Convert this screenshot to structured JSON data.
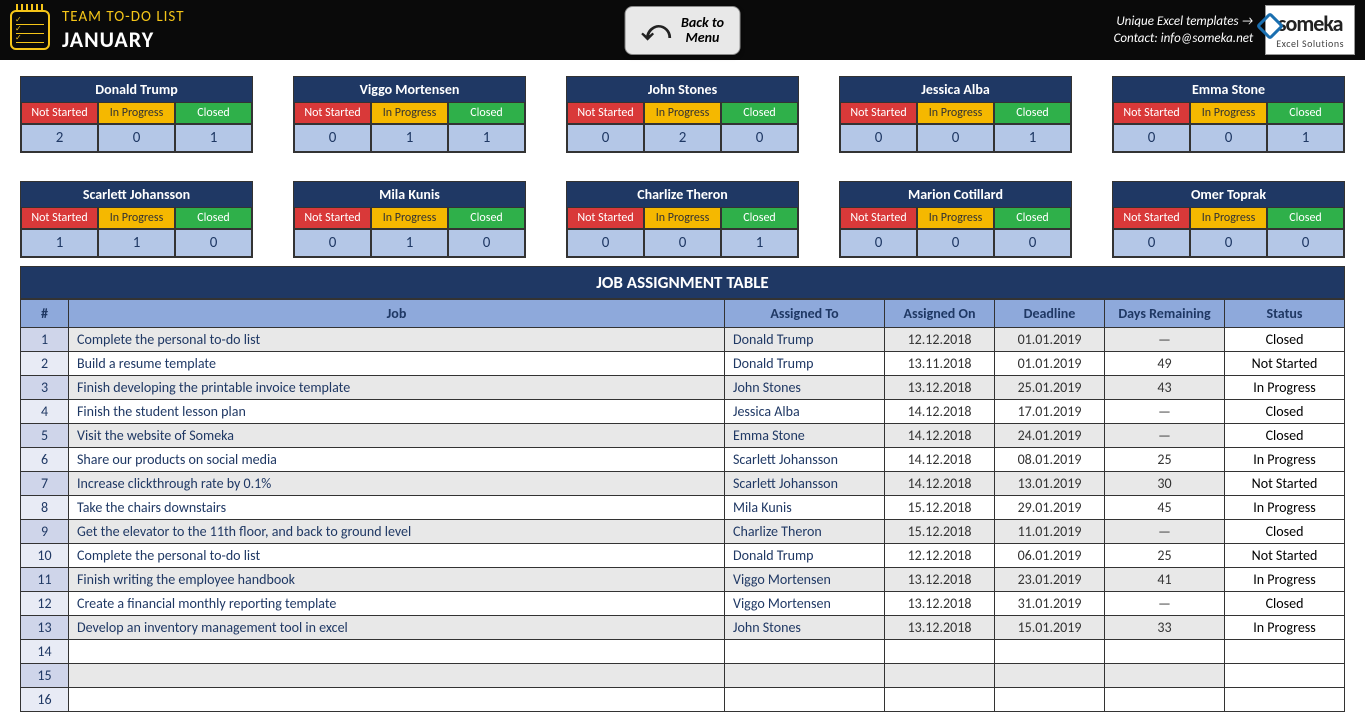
{
  "header": {
    "title_top": "TEAM TO-DO LIST",
    "title_bottom": "JANUARY",
    "back_arrow": "⤺",
    "back_line1": "Back to",
    "back_line2": "Menu",
    "templates_link": "Unique Excel templates →",
    "contact": "Contact: info@someka.net",
    "brand": "someka",
    "brand_sub": "Excel Solutions"
  },
  "status_labels": {
    "ns": "Not Started",
    "ip": "In Progress",
    "cl": "Closed"
  },
  "people": [
    {
      "name": "Donald Trump",
      "ns": 2,
      "ip": 0,
      "cl": 1
    },
    {
      "name": "Viggo Mortensen",
      "ns": 0,
      "ip": 1,
      "cl": 1
    },
    {
      "name": "John Stones",
      "ns": 0,
      "ip": 2,
      "cl": 0
    },
    {
      "name": "Jessica Alba",
      "ns": 0,
      "ip": 0,
      "cl": 1
    },
    {
      "name": "Emma Stone",
      "ns": 0,
      "ip": 0,
      "cl": 1
    },
    {
      "name": "Scarlett Johansson",
      "ns": 1,
      "ip": 1,
      "cl": 0
    },
    {
      "name": "Mila Kunis",
      "ns": 0,
      "ip": 1,
      "cl": 0
    },
    {
      "name": "Charlize Theron",
      "ns": 0,
      "ip": 0,
      "cl": 1
    },
    {
      "name": "Marion Cotillard",
      "ns": 0,
      "ip": 0,
      "cl": 0
    },
    {
      "name": "Omer Toprak",
      "ns": 0,
      "ip": 0,
      "cl": 0
    }
  ],
  "table": {
    "title": "JOB ASSIGNMENT TABLE",
    "headers": {
      "num": "#",
      "job": "Job",
      "assigned_to": "Assigned To",
      "assigned_on": "Assigned On",
      "deadline": "Deadline",
      "days": "Days Remaining",
      "status": "Status"
    },
    "rows": [
      {
        "num": 1,
        "job": "Complete the personal to-do list",
        "assigned_to": "Donald Trump",
        "assigned_on": "12.12.2018",
        "deadline": "01.01.2019",
        "days": "—",
        "status": "Closed"
      },
      {
        "num": 2,
        "job": "Build a resume template",
        "assigned_to": "Donald Trump",
        "assigned_on": "13.11.2018",
        "deadline": "01.01.2019",
        "days": "49",
        "status": "Not Started"
      },
      {
        "num": 3,
        "job": "Finish developing the printable invoice template",
        "assigned_to": "John Stones",
        "assigned_on": "13.12.2018",
        "deadline": "25.01.2019",
        "days": "43",
        "status": "In Progress"
      },
      {
        "num": 4,
        "job": "Finish the student lesson plan",
        "assigned_to": "Jessica Alba",
        "assigned_on": "14.12.2018",
        "deadline": "17.01.2019",
        "days": "—",
        "status": "Closed"
      },
      {
        "num": 5,
        "job": "Visit the website of Someka",
        "assigned_to": "Emma Stone",
        "assigned_on": "14.12.2018",
        "deadline": "24.01.2019",
        "days": "—",
        "status": "Closed"
      },
      {
        "num": 6,
        "job": "Share our products on social media",
        "assigned_to": "Scarlett Johansson",
        "assigned_on": "14.12.2018",
        "deadline": "08.01.2019",
        "days": "25",
        "status": "In Progress"
      },
      {
        "num": 7,
        "job": "Increase clickthrough rate by 0.1%",
        "assigned_to": "Scarlett Johansson",
        "assigned_on": "14.12.2018",
        "deadline": "13.01.2019",
        "days": "30",
        "status": "Not Started"
      },
      {
        "num": 8,
        "job": "Take the chairs downstairs",
        "assigned_to": "Mila Kunis",
        "assigned_on": "15.12.2018",
        "deadline": "29.01.2019",
        "days": "45",
        "status": "In Progress"
      },
      {
        "num": 9,
        "job": "Get the elevator to the 11th floor, and back to ground level",
        "assigned_to": "Charlize Theron",
        "assigned_on": "15.12.2018",
        "deadline": "11.01.2019",
        "days": "—",
        "status": "Closed"
      },
      {
        "num": 10,
        "job": "Complete the personal to-do list",
        "assigned_to": "Donald Trump",
        "assigned_on": "12.12.2018",
        "deadline": "06.01.2019",
        "days": "25",
        "status": "Not Started"
      },
      {
        "num": 11,
        "job": "Finish writing the employee handbook",
        "assigned_to": "Viggo Mortensen",
        "assigned_on": "13.12.2018",
        "deadline": "23.01.2019",
        "days": "41",
        "status": "In Progress"
      },
      {
        "num": 12,
        "job": "Create a financial monthly reporting template",
        "assigned_to": "Viggo Mortensen",
        "assigned_on": "13.12.2018",
        "deadline": "31.01.2019",
        "days": "—",
        "status": "Closed"
      },
      {
        "num": 13,
        "job": "Develop an inventory management tool in excel",
        "assigned_to": "John Stones",
        "assigned_on": "13.12.2018",
        "deadline": "15.01.2019",
        "days": "33",
        "status": "In Progress"
      },
      {
        "num": 14,
        "job": "",
        "assigned_to": "",
        "assigned_on": "",
        "deadline": "",
        "days": "",
        "status": ""
      },
      {
        "num": 15,
        "job": "",
        "assigned_to": "",
        "assigned_on": "",
        "deadline": "",
        "days": "",
        "status": ""
      },
      {
        "num": 16,
        "job": "",
        "assigned_to": "",
        "assigned_on": "",
        "deadline": "",
        "days": "",
        "status": ""
      }
    ]
  }
}
